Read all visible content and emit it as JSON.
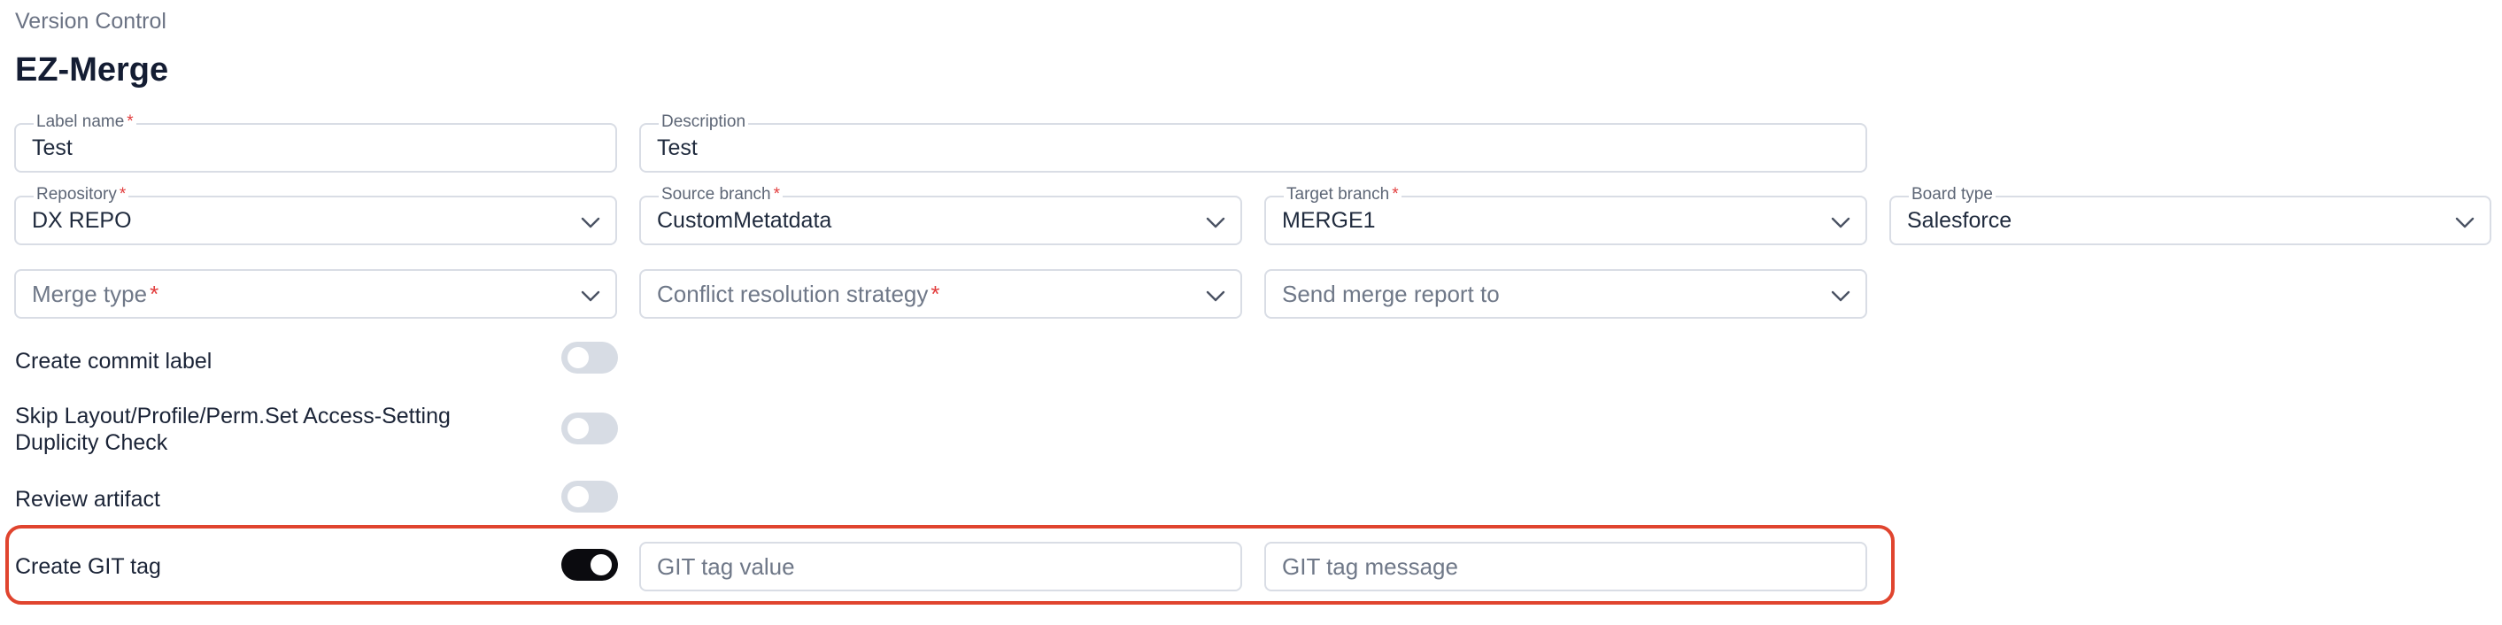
{
  "header": {
    "breadcrumb": "Version Control",
    "title": "EZ-Merge"
  },
  "form": {
    "label_name": {
      "label": "Label name",
      "required": "*",
      "value": "Test"
    },
    "description": {
      "label": "Description",
      "value": "Test"
    },
    "repository": {
      "label": "Repository",
      "required": "*",
      "value": "DX REPO"
    },
    "source_branch": {
      "label": "Source branch",
      "required": "*",
      "value": "CustomMetatdata"
    },
    "target_branch": {
      "label": "Target branch",
      "required": "*",
      "value": "MERGE1"
    },
    "board_type": {
      "label": "Board type",
      "value": "Salesforce"
    },
    "merge_type": {
      "placeholder": "Merge type",
      "required": "*"
    },
    "conflict_strategy": {
      "placeholder": "Conflict resolution strategy",
      "required": "*"
    },
    "merge_report": {
      "placeholder": "Send merge report to"
    }
  },
  "toggles": [
    {
      "label": "Create commit label",
      "on": false
    },
    {
      "label_line1": "Skip Layout/Profile/Perm.Set Access-Setting",
      "label_line2": "Duplicity Check",
      "on": false
    },
    {
      "label": "Review artifact",
      "on": false
    },
    {
      "label": "Create GIT tag",
      "on": true
    }
  ],
  "git_tag": {
    "value_placeholder": "GIT tag value",
    "message_placeholder": "GIT tag message"
  },
  "colors": {
    "highlight": "#e0442e",
    "required": "#e23d3d",
    "toggle_on": "#0b0b0f",
    "toggle_off": "#d7dce4"
  }
}
